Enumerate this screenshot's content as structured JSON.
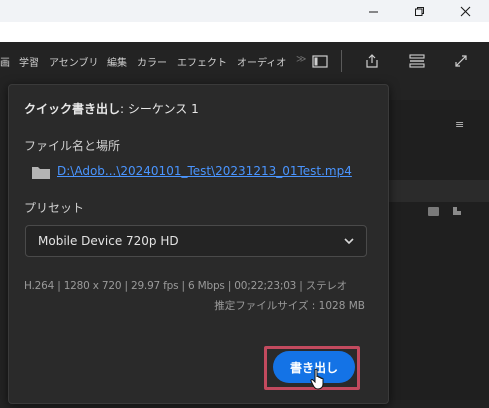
{
  "window": {
    "minimize_icon": "minimize-icon",
    "maximize_icon": "restore-icon",
    "close_icon": "close-icon"
  },
  "workspace_tabs": [
    "画",
    "学習",
    "アセンブリ",
    "編集",
    "カラー",
    "エフェクト",
    "オーディオ",
    "≫"
  ],
  "header_icons": [
    "panel-layout-icon",
    "share-icon",
    "quick-export-icon",
    "fullscreen-icon"
  ],
  "quick_export": {
    "title_bold": "クイック書き出し",
    "title_rest": ": シーケンス 1",
    "file_label": "ファイル名と場所",
    "file_path": "D:\\Adob...\\20240101_Test\\20231213_01Test.mp4",
    "preset_label": "プリセット",
    "preset_value": "Mobile Device 720p HD",
    "info_line1": "H.264 | 1280 x 720 | 29.97 fps | 6 Mbps | 00;22;23;03 | ステレオ",
    "info_line2": "推定ファイルサイズ : 1028 MB",
    "export_button": "書き出し"
  },
  "colors": {
    "accent": "#1473e6",
    "link": "#4a95ff",
    "highlight_frame": "#c24a5e",
    "popup_bg": "#2a2a2a"
  }
}
